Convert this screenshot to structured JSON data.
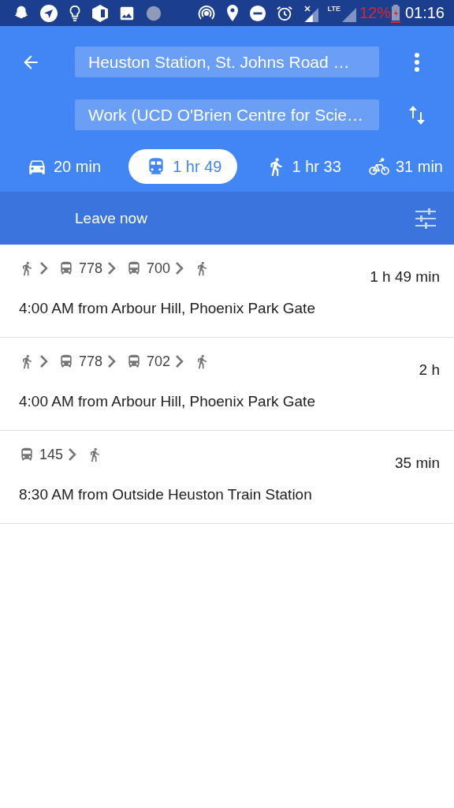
{
  "status_bar": {
    "network": "LTE",
    "battery": "12%",
    "time": "01:16"
  },
  "header": {
    "origin": "Heuston Station, St. Johns Road …",
    "destination": "Work (UCD O'Brien Centre for Scie…"
  },
  "modes": [
    {
      "kind": "car",
      "label": "20 min",
      "selected": false
    },
    {
      "kind": "transit",
      "label": "1 hr 49",
      "selected": true
    },
    {
      "kind": "walk",
      "label": "1 hr 33",
      "selected": false
    },
    {
      "kind": "bike",
      "label": "31 min",
      "selected": false
    }
  ],
  "options_bar": {
    "label": "Leave now"
  },
  "routes": [
    {
      "steps": [
        {
          "kind": "walk"
        },
        {
          "kind": "bus",
          "label": "778"
        },
        {
          "kind": "bus",
          "label": "700"
        },
        {
          "kind": "walk"
        }
      ],
      "duration": "1 h 49 min",
      "departure": "4:00 AM from Arbour Hill, Phoenix Park Gate"
    },
    {
      "steps": [
        {
          "kind": "walk"
        },
        {
          "kind": "bus",
          "label": "778"
        },
        {
          "kind": "bus",
          "label": "702"
        },
        {
          "kind": "walk"
        }
      ],
      "duration": "2 h",
      "departure": "4:00 AM from Arbour Hill, Phoenix Park Gate"
    },
    {
      "steps": [
        {
          "kind": "bus",
          "label": "145"
        },
        {
          "kind": "walk"
        }
      ],
      "duration": "35 min",
      "departure": "8:30 AM from Outside Heuston Train Station"
    }
  ]
}
